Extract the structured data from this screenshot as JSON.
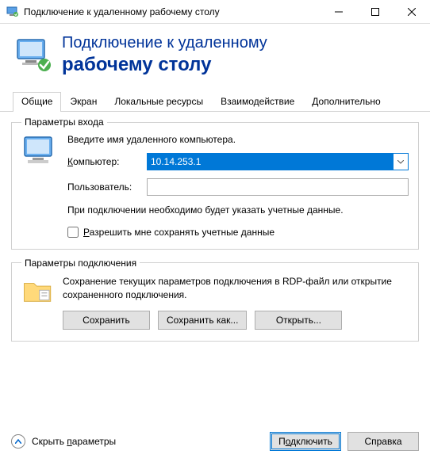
{
  "window": {
    "title": "Подключение к удаленному рабочему столу"
  },
  "header": {
    "line1": "Подключение к удаленному",
    "line2": "рабочему столу"
  },
  "tabs": {
    "general": "Общие",
    "display": "Экран",
    "local": "Локальные ресурсы",
    "experience": "Взаимодействие",
    "advanced": "Дополнительно"
  },
  "login": {
    "legend": "Параметры входа",
    "intro": "Введите имя удаленного компьютера.",
    "computer_label_pre": "К",
    "computer_label_mid": "омпьютер:",
    "computer_value": "10.14.253.1",
    "user_label": "Пользователь:",
    "user_value": "",
    "note": "При подключении необходимо будет указать учетные данные.",
    "checkbox_pre": "Р",
    "checkbox_mid": "азрешить мне сохранять учетные данные"
  },
  "conn": {
    "legend": "Параметры подключения",
    "text": "Сохранение текущих параметров подключения в RDP-файл или открытие сохраненного подключения.",
    "save": "Сохранить",
    "saveas": "Сохранить как...",
    "open": "Открыть..."
  },
  "footer": {
    "hide_pre": "Скрыть ",
    "hide_u": "п",
    "hide_post": "араметры",
    "connect_pre": "П",
    "connect_u": "о",
    "connect_post": "дключить",
    "help": "Справка"
  }
}
